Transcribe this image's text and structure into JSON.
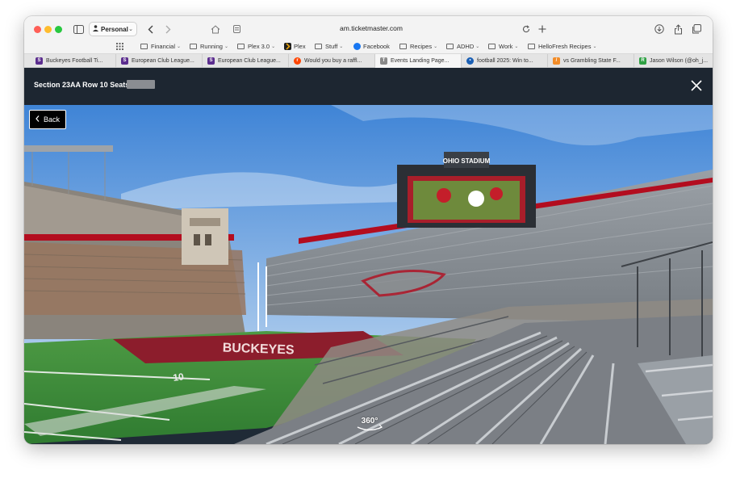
{
  "browser": {
    "profile_label": "Personal",
    "url": "am.ticketmaster.com"
  },
  "bookmarks": [
    {
      "label": "Financial",
      "type": "folder",
      "caret": "⌄"
    },
    {
      "label": "Running",
      "type": "folder",
      "caret": "⌄"
    },
    {
      "label": "Plex 3.0",
      "type": "folder",
      "caret": "⌄"
    },
    {
      "label": "Plex",
      "type": "site",
      "color": "#e5a00d"
    },
    {
      "label": "Stuff",
      "type": "folder",
      "caret": "⌄"
    },
    {
      "label": "Facebook",
      "type": "site",
      "color": "#1877f2"
    },
    {
      "label": "Recipes",
      "type": "folder",
      "caret": "⌄"
    },
    {
      "label": "ADHD",
      "type": "folder",
      "caret": "⌄"
    },
    {
      "label": "Work",
      "type": "folder",
      "caret": "⌄"
    },
    {
      "label": "HelloFresh Recipes",
      "type": "folder",
      "caret": "⌄"
    }
  ],
  "tabs": [
    {
      "label": "Buckeyes Football Ti...",
      "fav_color": "#5b2d8e",
      "fav_text": "S"
    },
    {
      "label": "European Club League...",
      "fav_color": "#5b2d8e",
      "fav_text": "S"
    },
    {
      "label": "European Club League...",
      "fav_color": "#5b2d8e",
      "fav_text": "S"
    },
    {
      "label": "Would you buy a raffl...",
      "fav_color": "#ff4500",
      "fav_text": "r"
    },
    {
      "label": "Events Landing Page...",
      "fav_color": "#8a8a8a",
      "fav_text": "T"
    },
    {
      "label": "football 2025: Win to...",
      "fav_color": "#1a5fb4",
      "fav_text": "•"
    },
    {
      "label": "vs Grambling State F...",
      "fav_color": "#f28c28",
      "fav_text": "/"
    },
    {
      "label": "Jason Wilson (@oh_j...",
      "fav_color": "#2ea043",
      "fav_text": "R"
    }
  ],
  "viewer": {
    "seat_title": "Section 23AA Row 10 Seats",
    "back_label": "Back",
    "view_360_label": "360°",
    "scoreboard_text": "OHIO STADIUM",
    "endzone_text": "BUCKEYES"
  },
  "colors": {
    "header_bg": "#1d2631",
    "sky": "#4a8fd8",
    "turf": "#3d8a3a",
    "endzone": "#8c1d2c",
    "scarlet": "#bb0000"
  }
}
